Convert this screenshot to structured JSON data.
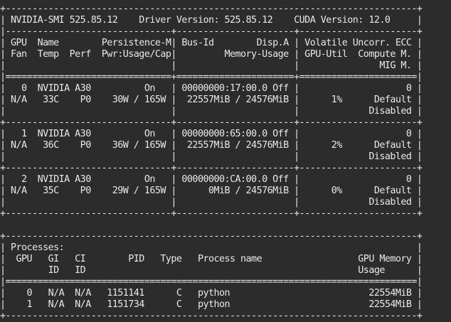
{
  "terminal": {
    "lines": [
      "+-----------------------------------------------------------------------------+",
      "| NVIDIA-SMI 525.85.12    Driver Version: 525.85.12    CUDA Version: 12.0     |",
      "|-------------------------------+----------------------+----------------------+",
      "| GPU  Name        Persistence-M| Bus-Id        Disp.A | Volatile Uncorr. ECC |",
      "| Fan  Temp  Perf  Pwr:Usage/Cap|         Memory-Usage | GPU-Util  Compute M. |",
      "|                               |                      |               MIG M. |",
      "|===============================+======================+======================|",
      "|   0  NVIDIA A30          On   | 00000000:17:00.0 Off |                    0 |",
      "| N/A   33C    P0    30W / 165W |  22557MiB / 24576MiB |      1%      Default |",
      "|                               |                      |             Disabled |",
      "+-------------------------------+----------------------+----------------------+",
      "|   1  NVIDIA A30          On   | 00000000:65:00.0 Off |                    0 |",
      "| N/A   36C    P0    36W / 165W |  22557MiB / 24576MiB |      2%      Default |",
      "|                               |                      |             Disabled |",
      "+-------------------------------+----------------------+----------------------+",
      "|   2  NVIDIA A30          On   | 00000000:CA:00.0 Off |                    0 |",
      "| N/A   35C    P0    29W / 165W |      0MiB / 24576MiB |      0%      Default |",
      "|                               |                      |             Disabled |",
      "+-------------------------------+----------------------+----------------------+",
      "",
      "+-----------------------------------------------------------------------------+",
      "| Processes:                                                                  |",
      "|  GPU   GI   CI        PID   Type   Process name                  GPU Memory |",
      "|        ID   ID                                                   Usage      |",
      "|=============================================================================|",
      "|    0   N/A  N/A   1151141      C   python                          22554MiB |",
      "|    1   N/A  N/A   1151734      C   python                          22554MiB |",
      "+-----------------------------------------------------------------------------+"
    ]
  }
}
